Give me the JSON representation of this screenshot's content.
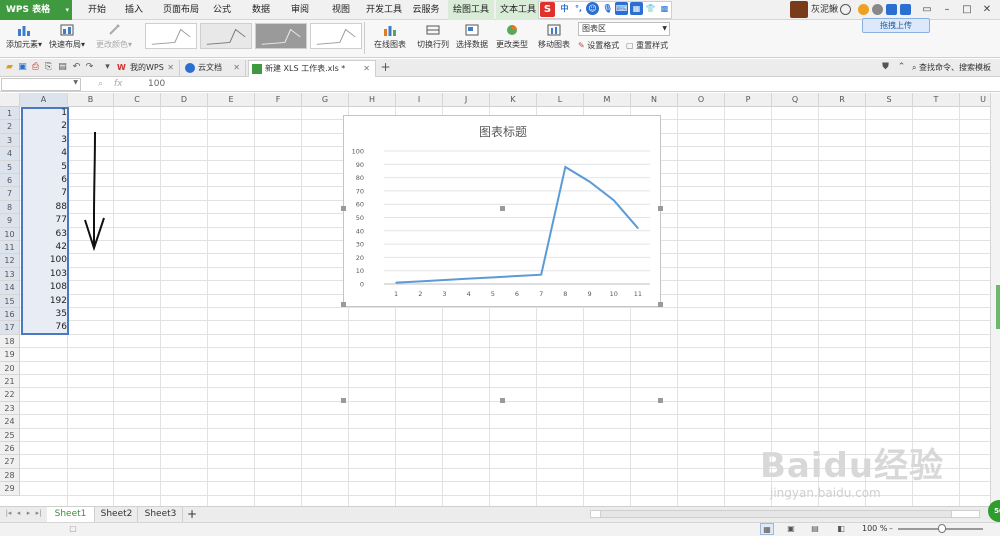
{
  "app": {
    "name": "WPS 表格"
  },
  "menu": {
    "items": [
      "开始",
      "插入",
      "页面布局",
      "公式",
      "数据",
      "审阅",
      "视图",
      "开发工具",
      "云服务"
    ],
    "context_items": [
      "绘图工具",
      "文本工具"
    ]
  },
  "user": {
    "name": "灰泥鳅"
  },
  "ribbon": {
    "add_element": "添加元素",
    "quick_layout": "快速布局",
    "change_color": "更改颜色",
    "online_chart": "在线图表",
    "switch_row_col": "切换行列",
    "select_data": "选择数据",
    "change_type": "更改类型",
    "move_chart": "移动图表",
    "chart_area_select": "图表区",
    "set_format": "设置格式",
    "reset_style": "重置样式",
    "upload_button": "拖拽上传"
  },
  "tabs": {
    "items": [
      {
        "label": "我的WPS"
      },
      {
        "label": "云文档"
      },
      {
        "label": "新建 XLS 工作表.xls *"
      }
    ],
    "add": "+",
    "search_cmd": "查找命令、搜索模板"
  },
  "formula_bar": {
    "fx_label": "fx",
    "value": "100"
  },
  "grid": {
    "columns": [
      "A",
      "B",
      "C",
      "D",
      "E",
      "F",
      "G",
      "H",
      "I",
      "J",
      "K",
      "L",
      "M",
      "N",
      "O",
      "P",
      "Q",
      "R",
      "S",
      "T",
      "U"
    ],
    "rows": [
      "1",
      "2",
      "3",
      "4",
      "5",
      "6",
      "7",
      "8",
      "9",
      "10",
      "11",
      "12",
      "13",
      "14",
      "15",
      "16",
      "17",
      "18",
      "19",
      "20",
      "21",
      "22",
      "23",
      "24",
      "25",
      "26",
      "27",
      "28",
      "29"
    ],
    "column_a_values": [
      "1",
      "2",
      "3",
      "4",
      "5",
      "6",
      "7",
      "88",
      "77",
      "63",
      "42",
      "100",
      "103",
      "108",
      "192",
      "35",
      "76"
    ]
  },
  "chart_data": {
    "type": "line",
    "title": "图表标题",
    "categories": [
      "1",
      "2",
      "3",
      "4",
      "5",
      "6",
      "7",
      "8",
      "9",
      "10",
      "11"
    ],
    "series": [
      {
        "values": [
          1,
          2,
          3,
          4,
          5,
          6,
          7,
          88,
          77,
          63,
          42
        ]
      }
    ],
    "ylim": [
      0,
      100
    ],
    "yticks": [
      "0",
      "10",
      "20",
      "30",
      "40",
      "50",
      "60",
      "70",
      "80",
      "90",
      "100"
    ],
    "grid": true,
    "color": "#5b9bd5"
  },
  "sheets": {
    "items": [
      "Sheet1",
      "Sheet2",
      "Sheet3"
    ],
    "active": "Sheet1",
    "add": "+"
  },
  "status": {
    "zoom": "100 %"
  },
  "watermark": {
    "text": "Baidu经验",
    "sub": "jingyan.baidu.com"
  },
  "badge": "50"
}
